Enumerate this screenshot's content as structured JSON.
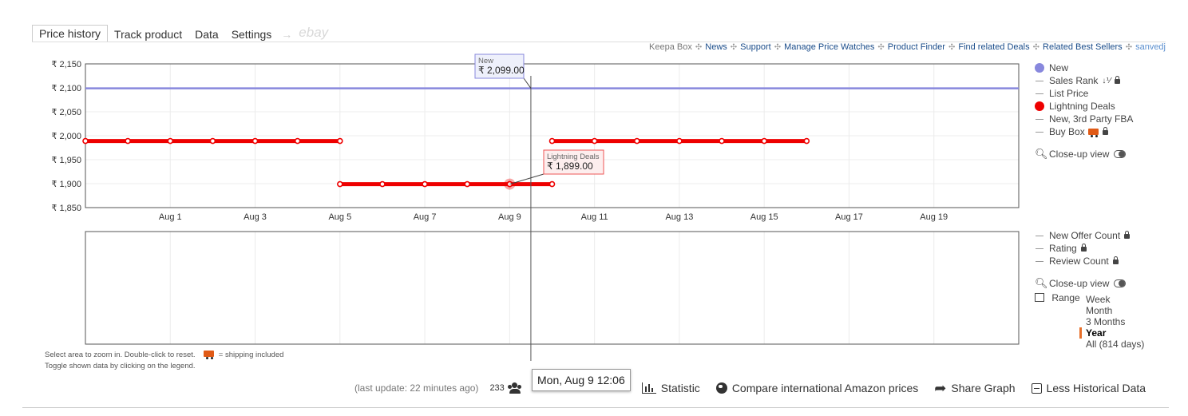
{
  "tabs": [
    {
      "label": "Price history",
      "active": true
    },
    {
      "label": "Track product",
      "active": false
    },
    {
      "label": "Data",
      "active": false
    },
    {
      "label": "Settings",
      "active": false
    }
  ],
  "tab_arrow": "→",
  "tab_ebay": "ebay",
  "links": {
    "keepa_box": "Keepa Box",
    "news": "News",
    "support": "Support",
    "manage": "Manage Price Watches",
    "finder": "Product Finder",
    "deals": "Find related Deals",
    "bestsellers": "Related Best Sellers",
    "user": "sanvedj",
    "separator": "✣"
  },
  "legend_top": [
    {
      "label": "New",
      "type": "dot",
      "color": "#8888dd"
    },
    {
      "label": "Sales Rank",
      "type": "dash",
      "sort_icon": "↓⅟",
      "locked": true
    },
    {
      "label": "List Price",
      "type": "dash"
    },
    {
      "label": "Lightning Deals",
      "type": "dot",
      "color": "#ee0000"
    },
    {
      "label": "New, 3rd Party FBA",
      "type": "dash"
    },
    {
      "label": "Buy Box",
      "type": "dash",
      "truck": true,
      "locked": true
    }
  ],
  "closeup_label": "Close-up view",
  "legend_bottom": [
    {
      "label": "New Offer Count",
      "locked": true
    },
    {
      "label": "Rating",
      "locked": true
    },
    {
      "label": "Review Count",
      "locked": true
    }
  ],
  "range": {
    "label": "Range",
    "options": [
      "Week",
      "Month",
      "3 Months",
      "Year",
      "All (814 days)"
    ],
    "selected": "Year"
  },
  "notes": {
    "line1a": "Select area to zoom in. Double-click to reset.",
    "line1b": "= shipping included",
    "line2": "Toggle shown data by clicking on the legend."
  },
  "bottom": {
    "last_update": "(last update: 22 minutes ago)",
    "count": "233",
    "statistic": "Statistic",
    "compare": "Compare international Amazon prices",
    "share": "Share Graph",
    "less": "Less Historical Data"
  },
  "time_tooltip": "Mon, Aug 9 12:06",
  "chart_data": {
    "type": "line",
    "y_ticks": [
      "₹ 2,150",
      "₹ 2,100",
      "₹ 2,050",
      "₹ 2,000",
      "₹ 1,950",
      "₹ 1,900",
      "₹ 1,850"
    ],
    "ylim": [
      1850,
      2150
    ],
    "x_range_days": [
      30.0,
      52.0
    ],
    "x_ticks": [
      {
        "day": 32,
        "label": "Aug 1"
      },
      {
        "day": 34,
        "label": "Aug 3"
      },
      {
        "day": 36,
        "label": "Aug 5"
      },
      {
        "day": 38,
        "label": "Aug 7"
      },
      {
        "day": 40,
        "label": "Aug 9"
      },
      {
        "day": 42,
        "label": "Aug 11"
      },
      {
        "day": 44,
        "label": "Aug 13"
      },
      {
        "day": 46,
        "label": "Aug 15"
      },
      {
        "day": 48,
        "label": "Aug 17"
      },
      {
        "day": 50,
        "label": "Aug 19"
      }
    ],
    "grid": true,
    "series": [
      {
        "name": "New",
        "color": "#8888dd",
        "points": [
          [
            30.0,
            2099
          ],
          [
            52.0,
            2099
          ]
        ]
      },
      {
        "name": "Lightning Deals",
        "color": "#ee0000",
        "segments": [
          [
            [
              30.0,
              1989
            ],
            [
              31.0,
              1989
            ],
            [
              32.0,
              1989
            ],
            [
              33.0,
              1989
            ],
            [
              34.0,
              1989
            ],
            [
              35.0,
              1989
            ],
            [
              36.0,
              1989
            ]
          ],
          [
            [
              36.0,
              1899
            ],
            [
              37.0,
              1899
            ],
            [
              38.0,
              1899
            ],
            [
              39.0,
              1899
            ],
            [
              40.0,
              1899
            ],
            [
              41.0,
              1899
            ]
          ],
          [
            [
              41.0,
              1989
            ],
            [
              42.0,
              1989
            ],
            [
              43.0,
              1989
            ],
            [
              44.0,
              1989
            ],
            [
              45.0,
              1989
            ],
            [
              46.0,
              1989
            ],
            [
              47.0,
              1989
            ]
          ]
        ]
      }
    ],
    "crosshair_day": 40.5,
    "tooltips": [
      {
        "series": "New",
        "label": "New",
        "value": "₹ 2,099.00"
      },
      {
        "series": "Lightning Deals",
        "label": "Lightning Deals",
        "value": "₹ 1,899.00"
      }
    ]
  }
}
